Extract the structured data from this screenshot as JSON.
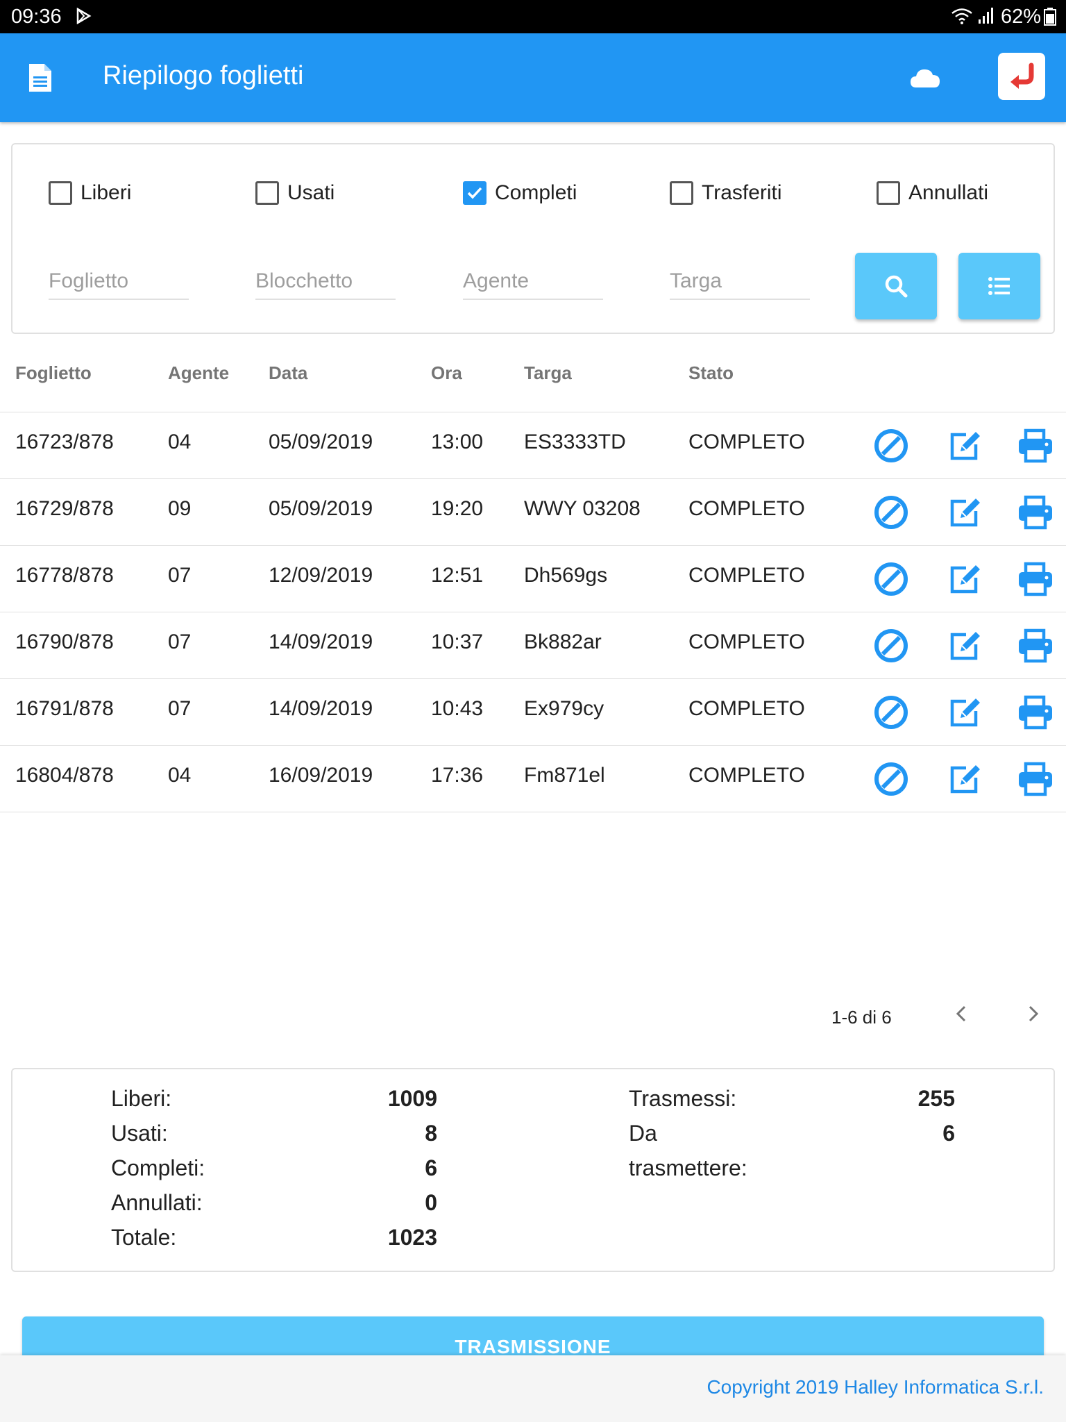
{
  "status_bar": {
    "time": "09:36",
    "battery": "62%"
  },
  "app_bar": {
    "title": "Riepilogo foglietti"
  },
  "filters": {
    "checkboxes": [
      {
        "label": "Liberi",
        "checked": false
      },
      {
        "label": "Usati",
        "checked": false
      },
      {
        "label": "Completi",
        "checked": true
      },
      {
        "label": "Trasferiti",
        "checked": false
      },
      {
        "label": "Annullati",
        "checked": false
      }
    ],
    "inputs": [
      {
        "placeholder": "Foglietto",
        "value": ""
      },
      {
        "placeholder": "Blocchetto",
        "value": ""
      },
      {
        "placeholder": "Agente",
        "value": ""
      },
      {
        "placeholder": "Targa",
        "value": ""
      }
    ]
  },
  "table": {
    "headers": [
      "Foglietto",
      "Agente",
      "Data",
      "Ora",
      "Targa",
      "Stato"
    ],
    "rows": [
      {
        "foglietto": "16723/878",
        "agente": "04",
        "data": "05/09/2019",
        "ora": "13:00",
        "targa": "ES3333TD",
        "stato": "COMPLETO"
      },
      {
        "foglietto": "16729/878",
        "agente": "09",
        "data": "05/09/2019",
        "ora": "19:20",
        "targa": "WWY 03208",
        "stato": "COMPLETO"
      },
      {
        "foglietto": "16778/878",
        "agente": "07",
        "data": "12/09/2019",
        "ora": "12:51",
        "targa": "Dh569gs",
        "stato": "COMPLETO"
      },
      {
        "foglietto": "16790/878",
        "agente": "07",
        "data": "14/09/2019",
        "ora": "10:37",
        "targa": "Bk882ar",
        "stato": "COMPLETO"
      },
      {
        "foglietto": "16791/878",
        "agente": "07",
        "data": "14/09/2019",
        "ora": "10:43",
        "targa": "Ex979cy",
        "stato": "COMPLETO"
      },
      {
        "foglietto": "16804/878",
        "agente": "04",
        "data": "16/09/2019",
        "ora": "17:36",
        "targa": "Fm871el",
        "stato": "COMPLETO"
      }
    ],
    "row_actions": [
      "cancel-icon",
      "edit-icon",
      "print-icon"
    ]
  },
  "pagination": {
    "label": "1-6 di 6"
  },
  "summary": {
    "left": [
      {
        "label": "Liberi:",
        "value": "1009"
      },
      {
        "label": "Usati:",
        "value": "8"
      },
      {
        "label": "Completi:",
        "value": "6"
      },
      {
        "label": "Annullati:",
        "value": "0"
      },
      {
        "label": "Totale:",
        "value": "1023"
      }
    ],
    "right": [
      {
        "label": "Trasmessi:",
        "value": "255"
      },
      {
        "label": "Da",
        "label2": "trasmettere:",
        "value": "6"
      }
    ]
  },
  "transmit_button": "TRASMISSIONE",
  "footer": {
    "copyright": "Copyright 2019 Halley Informatica S.r.l."
  },
  "colors": {
    "primary": "#2196f3",
    "button_light": "#5ac8fa",
    "icon_blue": "#2196f3",
    "back_arrow_red": "#e53935",
    "footer_link": "#1e88e5"
  }
}
